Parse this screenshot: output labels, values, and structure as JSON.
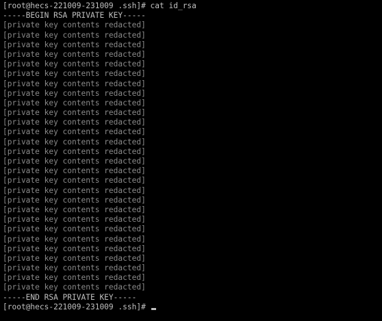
{
  "terminal": {
    "prompt_1": "[root@hecs-221009-231009 .ssh]# ",
    "command": "cat id_rsa",
    "begin_marker": "-----BEGIN RSA PRIVATE KEY-----",
    "key_lines": [
      "[private key contents redacted]",
      "[private key contents redacted]",
      "[private key contents redacted]",
      "[private key contents redacted]",
      "[private key contents redacted]",
      "[private key contents redacted]",
      "[private key contents redacted]",
      "[private key contents redacted]",
      "[private key contents redacted]",
      "[private key contents redacted]",
      "[private key contents redacted]",
      "[private key contents redacted]",
      "[private key contents redacted]",
      "[private key contents redacted]",
      "[private key contents redacted]",
      "[private key contents redacted]",
      "[private key contents redacted]",
      "[private key contents redacted]",
      "[private key contents redacted]",
      "[private key contents redacted]",
      "[private key contents redacted]",
      "[private key contents redacted]",
      "[private key contents redacted]",
      "[private key contents redacted]",
      "[private key contents redacted]",
      "[private key contents redacted]",
      "[private key contents redacted]",
      "[private key contents redacted]"
    ],
    "end_marker": "-----END RSA PRIVATE KEY-----",
    "prompt_2": "[root@hecs-221009-231009 .ssh]# "
  },
  "colors": {
    "background": "#000000",
    "text": "#c0c0c0"
  }
}
